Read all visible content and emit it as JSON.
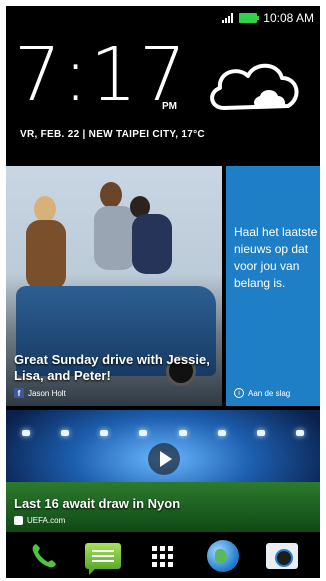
{
  "status_bar": {
    "time": "10:08 AM",
    "icons": [
      "signal-icon",
      "battery-icon"
    ],
    "battery_color": "#2fd24a"
  },
  "clock_widget": {
    "time": "7:17",
    "ampm": "PM",
    "date_location": "VR, FEB. 22 | NEW TAIPEI CITY, 17°C",
    "weather_icon": "cloud-icon"
  },
  "tiles": {
    "social": {
      "caption": "Great Sunday drive with Jessie, Lisa, and Peter!",
      "source": "Jason Holt",
      "icon": "facebook-icon"
    },
    "news_promo": {
      "message": "Haal het laatste nieuws op dat voor jou van belang is.",
      "footer": "Aan de slag",
      "icon": "info-icon",
      "color": "#1f7fc6"
    },
    "sports": {
      "caption": "Last 16 await draw in Nyon",
      "source": "UEFA.com",
      "icon": "play-icon"
    }
  },
  "dock": {
    "items": [
      "phone-icon",
      "messages-icon",
      "apps-icon",
      "browser-icon",
      "camera-icon"
    ]
  }
}
